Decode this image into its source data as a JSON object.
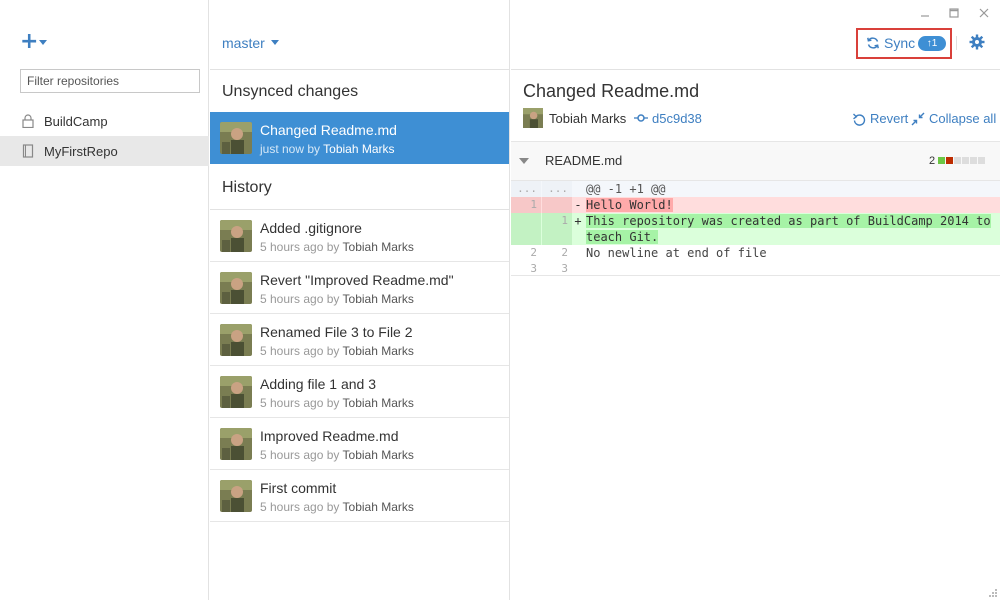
{
  "sidebar": {
    "add_tooltip": "",
    "filter_placeholder": "Filter repositories",
    "repos": [
      {
        "name": "BuildCamp",
        "icon": "lock-icon"
      },
      {
        "name": "MyFirstRepo",
        "icon": "book-icon",
        "selected": true
      }
    ]
  },
  "branch": {
    "name": "master"
  },
  "unsynced": {
    "title": "Unsynced changes",
    "commits": [
      {
        "message": "Changed Readme.md",
        "time": "just now by",
        "author": "Tobiah Marks"
      }
    ]
  },
  "history": {
    "title": "History",
    "commits": [
      {
        "message": "Added .gitignore",
        "time": "5 hours ago by",
        "author": "Tobiah Marks"
      },
      {
        "message": "Revert \"Improved Readme.md\"",
        "time": "5 hours ago by",
        "author": "Tobiah Marks"
      },
      {
        "message": "Renamed File 3 to File 2",
        "time": "5 hours ago by",
        "author": "Tobiah Marks"
      },
      {
        "message": "Adding file 1 and 3",
        "time": "5 hours ago by",
        "author": "Tobiah Marks"
      },
      {
        "message": "Improved Readme.md",
        "time": "5 hours ago by",
        "author": "Tobiah Marks"
      },
      {
        "message": "First commit",
        "time": "5 hours ago by",
        "author": "Tobiah Marks"
      }
    ]
  },
  "toolbar": {
    "sync_label": "Sync",
    "sync_badge": "↑1",
    "accent": "#3e7fc1",
    "highlight": "#d9403a"
  },
  "detail": {
    "title": "Changed Readme.md",
    "author": "Tobiah Marks",
    "sha": "d5c9d38",
    "revert_label": "Revert",
    "collapse_label": "Collapse all"
  },
  "file": {
    "name": "README.md",
    "change_count": "2"
  },
  "diff": {
    "hunk_left": "...",
    "hunk_right": "...",
    "hunk": "@@ -1 +1 @@",
    "deleted": {
      "old": "1",
      "new": "",
      "sign": "-",
      "text": "Hello World!"
    },
    "added": {
      "old": "",
      "new": "1",
      "sign": "+",
      "text": "This repository was created as part of BuildCamp 2014 to teach Git."
    },
    "context": [
      {
        "old": "2",
        "new": "2",
        "text": " No newline at end of file"
      },
      {
        "old": "3",
        "new": "3",
        "text": ""
      }
    ]
  }
}
